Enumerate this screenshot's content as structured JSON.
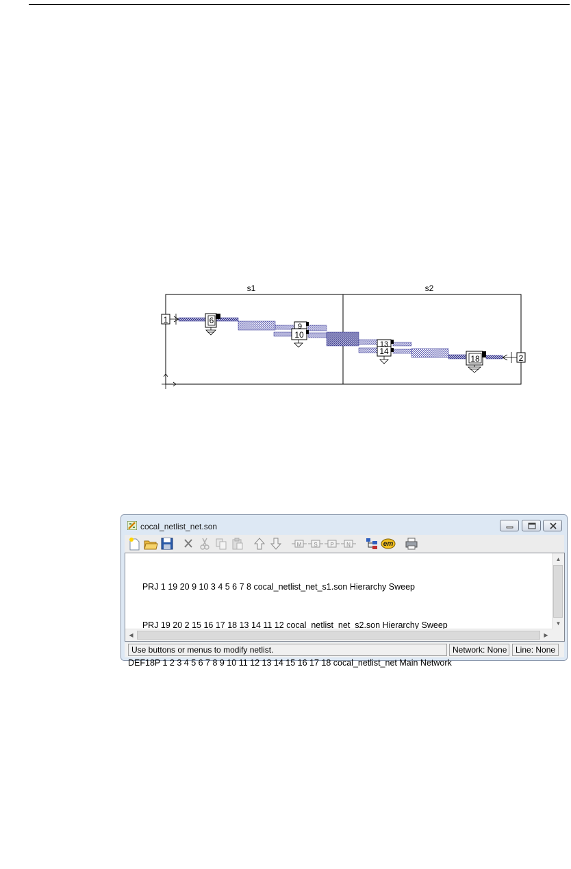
{
  "diagram": {
    "section_labels": [
      "s1",
      "s2"
    ],
    "port_labels": [
      "1",
      "2"
    ],
    "component_labels": [
      "6",
      "9",
      "10",
      "13",
      "14",
      "18"
    ],
    "colors": {
      "line": "#2f2f8f",
      "hatch": "#6b6bb8",
      "border": "#000000"
    }
  },
  "window": {
    "title": "cocal_netlist_net.son",
    "title_icon": "netlist-app-icon",
    "controls": {
      "minimize": "minimize-icon",
      "maximize": "maximize-icon",
      "close": "close-icon"
    }
  },
  "toolbar": {
    "buttons": [
      {
        "name": "new-icon"
      },
      {
        "name": "open-folder-icon"
      },
      {
        "name": "save-icon"
      },
      {
        "name": "delete-icon"
      },
      {
        "name": "cut-icon"
      },
      {
        "name": "copy-icon"
      },
      {
        "name": "paste-icon"
      },
      {
        "name": "move-up-icon"
      },
      {
        "name": "move-down-icon"
      },
      {
        "name": "add-m-icon",
        "label": "M"
      },
      {
        "name": "add-s-icon",
        "label": "S"
      },
      {
        "name": "add-p-icon",
        "label": "P"
      },
      {
        "name": "add-n-icon",
        "label": "N"
      },
      {
        "name": "hierarchy-icon"
      },
      {
        "name": "em-icon",
        "label": "em"
      },
      {
        "name": "print-icon"
      }
    ]
  },
  "netlist": {
    "lines": [
      "      PRJ 1 19 20 9 10 3 4 5 6 7 8 cocal_netlist_net_s1.son Hierarchy Sweep",
      "      PRJ 19 20 2 15 16 17 18 13 14 11 12 cocal_netlist_net_s2.son Hierarchy Sweep",
      "DEF18P 1 2 3 4 5 6 7 8 9 10 11 12 13 14 15 16 17 18 cocal_netlist_net Main Network"
    ]
  },
  "status": {
    "message": "Use buttons or menus to modify netlist.",
    "network": "Network: None",
    "line": "Line: None"
  }
}
